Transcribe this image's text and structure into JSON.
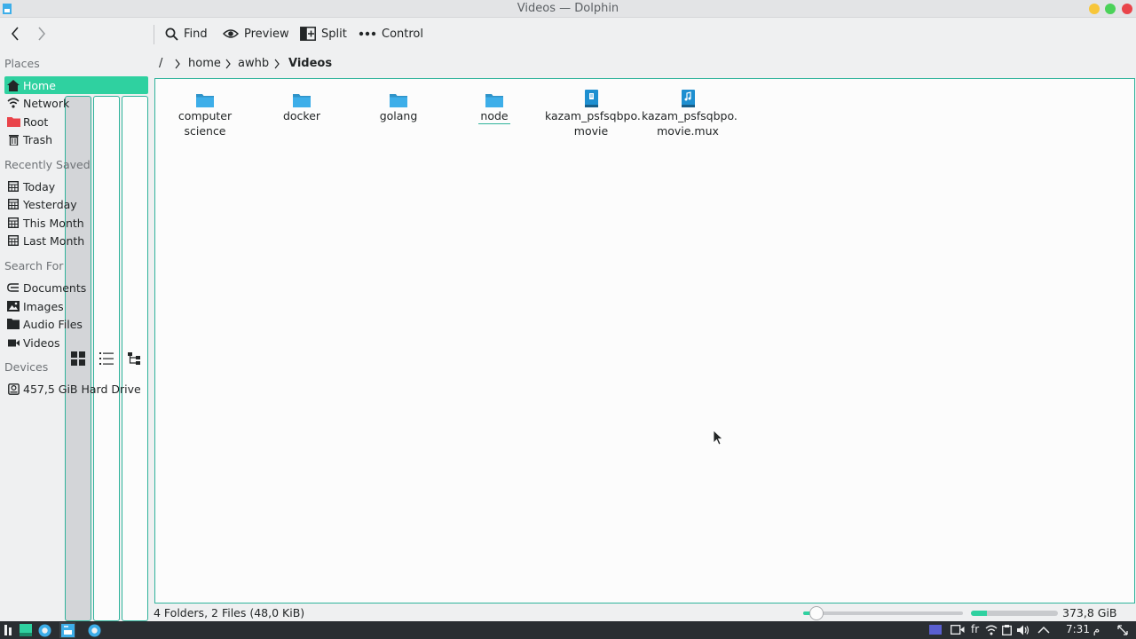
{
  "window": {
    "title": "Videos — Dolphin"
  },
  "toolbar": {
    "find_label": "Find",
    "preview_label": "Preview",
    "split_label": "Split",
    "control_label": "Control"
  },
  "sidebar": {
    "places_title": "Places",
    "places": [
      {
        "label": "Home",
        "icon": "home-icon"
      },
      {
        "label": "Network",
        "icon": "network-icon"
      },
      {
        "label": "Root",
        "icon": "folder-red-icon"
      },
      {
        "label": "Trash",
        "icon": "trash-icon"
      }
    ],
    "recent_title": "Recently Saved",
    "recent": [
      {
        "label": "Today",
        "icon": "calendar-icon"
      },
      {
        "label": "Yesterday",
        "icon": "calendar-icon"
      },
      {
        "label": "This Month",
        "icon": "calendar-icon"
      },
      {
        "label": "Last Month",
        "icon": "calendar-icon"
      }
    ],
    "search_title": "Search For",
    "search": [
      {
        "label": "Documents",
        "icon": "documents-icon"
      },
      {
        "label": "Images",
        "icon": "images-icon"
      },
      {
        "label": "Audio Files",
        "icon": "audio-icon"
      },
      {
        "label": "Videos",
        "icon": "video-icon"
      }
    ],
    "devices_title": "Devices",
    "devices": [
      {
        "label": "457,5 GiB Hard Drive",
        "icon": "hard-drive-icon"
      }
    ]
  },
  "breadcrumb": {
    "root": "/",
    "parts": [
      "home",
      "awhb"
    ],
    "current": "Videos"
  },
  "files": [
    {
      "line1": "computer science",
      "line2": "",
      "kind": "folder"
    },
    {
      "line1": "docker",
      "line2": "",
      "kind": "folder"
    },
    {
      "line1": "golang",
      "line2": "",
      "kind": "folder"
    },
    {
      "line1": "node",
      "line2": "",
      "kind": "folder"
    },
    {
      "line1": "kazam_psfsqbpo.",
      "line2": "movie",
      "kind": "document"
    },
    {
      "line1": "kazam_psfsqbpo.",
      "line2": "movie.mux",
      "kind": "audio"
    }
  ],
  "status": {
    "summary": "4 Folders, 2 Files (48,0 KiB)",
    "free_space": "373,8 GiB free",
    "used_fraction": 0.18,
    "zoom_fraction": 0.05
  },
  "taskbar": {
    "keyboard_layout": "fr",
    "clock": "7:31 م"
  },
  "colors": {
    "accent": "#2fd1a0",
    "folder": "#3daee9",
    "root_folder": "#e9444a"
  }
}
